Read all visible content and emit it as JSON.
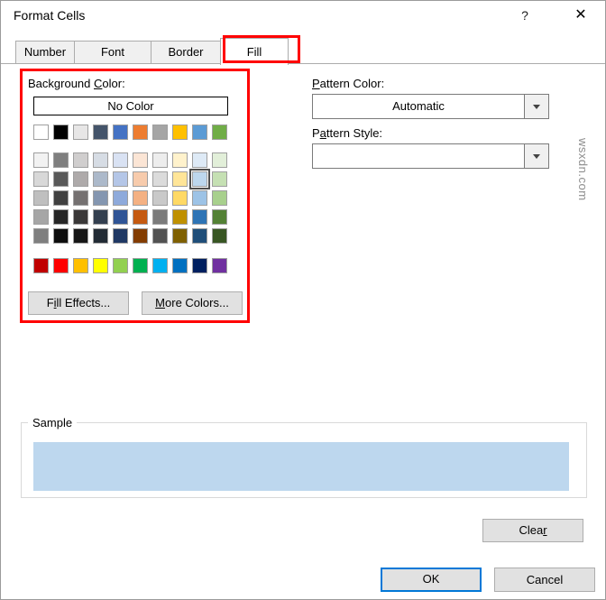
{
  "dialog": {
    "title": "Format Cells",
    "help_icon": "?",
    "close_icon": "✕"
  },
  "tabs": [
    {
      "label": "Number",
      "active": false
    },
    {
      "label": "Font",
      "active": false
    },
    {
      "label": "Border",
      "active": false
    },
    {
      "label": "Fill",
      "active": true
    }
  ],
  "fill_tab": {
    "background_color_label": "Background &Color:",
    "no_color_button": "No Color",
    "palette": {
      "theme_row": [
        "#FFFFFF",
        "#000000",
        "#E7E6E6",
        "#44546A",
        "#4472C4",
        "#ED7D31",
        "#A5A5A5",
        "#FFC000",
        "#5B9BD5",
        "#70AD47"
      ],
      "variant_rows": [
        [
          "#F2F2F2",
          "#7F7F7F",
          "#D0CECE",
          "#D6DCE4",
          "#D9E2F3",
          "#FBE5D5",
          "#EDEDED",
          "#FFF2CC",
          "#DEEAF6",
          "#E2EFD9"
        ],
        [
          "#D8D8D8",
          "#595959",
          "#AEAAAA",
          "#ACB9CA",
          "#B4C6E7",
          "#F7CBAC",
          "#DBDBDB",
          "#FFE598",
          "#BDD7EE",
          "#C5E0B3"
        ],
        [
          "#BFBFBF",
          "#404040",
          "#757171",
          "#8496B0",
          "#8EAADB",
          "#F4B183",
          "#C9C9C9",
          "#FFD965",
          "#9DC3E6",
          "#A8D08D"
        ],
        [
          "#A6A6A6",
          "#262626",
          "#3A3838",
          "#333F4F",
          "#2F5496",
          "#C55A11",
          "#7B7B7B",
          "#BF9000",
          "#2E74B5",
          "#538135"
        ],
        [
          "#7F7F7F",
          "#0D0D0D",
          "#161616",
          "#222B35",
          "#1F3864",
          "#833C00",
          "#525252",
          "#7F6000",
          "#1F4E79",
          "#385623"
        ]
      ],
      "standard_row": [
        "#C00000",
        "#FF0000",
        "#FFC000",
        "#FFFF00",
        "#92D050",
        "#00B050",
        "#00B0F0",
        "#0070C0",
        "#002060",
        "#7030A0"
      ],
      "selected": {
        "row": 1,
        "col": 8,
        "color": "#BDD7EE"
      }
    },
    "fill_effects_button": "F&ill Effects...",
    "more_colors_button": "&More Colors...",
    "pattern_color_label": "&Pattern Color:",
    "pattern_color_value": "Automatic",
    "pattern_style_label": "P&attern Style:",
    "pattern_style_value": ""
  },
  "sample": {
    "label": "Sample",
    "fill_color": "#BDD7EE"
  },
  "buttons": {
    "clear": "Clea&r",
    "ok": "OK",
    "cancel": "Cancel"
  },
  "annotations": {
    "highlight_color": "#FF0000"
  },
  "watermark": "wsxdn.com"
}
